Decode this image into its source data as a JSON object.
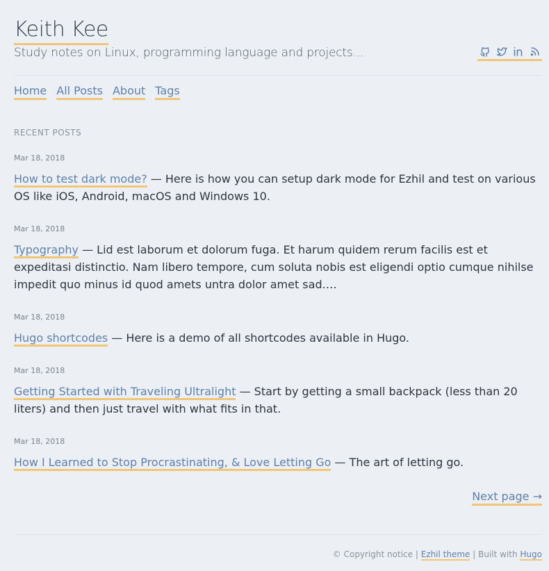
{
  "site": {
    "title": "Keith Kee",
    "description": "Study notes on Linux, programming language and projects..."
  },
  "social": [
    {
      "icon": "github-icon"
    },
    {
      "icon": "twitter-icon"
    },
    {
      "icon": "linkedin-icon"
    },
    {
      "icon": "rss-icon"
    }
  ],
  "nav": {
    "home": "Home",
    "all_posts": "All Posts",
    "about": "About",
    "tags": "Tags"
  },
  "section_heading": "RECENT POSTS",
  "posts": [
    {
      "date": "Mar 18, 2018",
      "title": "How to test dark mode?",
      "summary": " — Here is how you can setup dark mode for Ezhil and test on various OS like iOS, Android, macOS and Windows 10."
    },
    {
      "date": "Mar 18, 2018",
      "title": "Typography",
      "summary": " — Lid est laborum et dolorum fuga. Et harum quidem rerum facilis est et expeditasi distinctio. Nam libero tempore, cum soluta nobis est eligendi optio cumque nihilse impedit quo minus id quod amets untra dolor amet sad.…"
    },
    {
      "date": "Mar 18, 2018",
      "title": "Hugo shortcodes",
      "summary": " — Here is a demo of all shortcodes available in Hugo."
    },
    {
      "date": "Mar 18, 2018",
      "title": "Getting Started with Traveling Ultralight",
      "summary": " — Start by getting a small backpack (less than 20 liters) and then just travel with what fits in that."
    },
    {
      "date": "Mar 18, 2018",
      "title": "How I Learned to Stop Procrastinating, & Love Letting Go",
      "summary": " — The art of letting go."
    }
  ],
  "pagination": {
    "next": "Next page →"
  },
  "footer": {
    "copyright": "© Copyright notice | ",
    "theme_link": "Ezhil theme",
    "built_with": " | Built with ",
    "hugo_link": "Hugo"
  },
  "colors": {
    "background": "#eceff4",
    "link": "#5e81ac",
    "underline_accent": "#f0c674",
    "text": "#2e3440"
  }
}
